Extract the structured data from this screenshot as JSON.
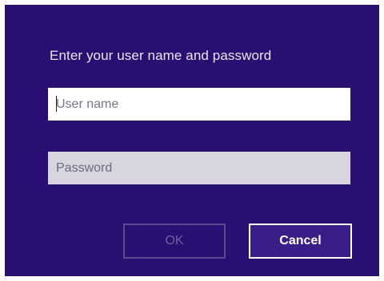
{
  "dialog": {
    "prompt": "Enter your user name and password",
    "username": {
      "placeholder": "User name",
      "value": ""
    },
    "password": {
      "placeholder": "Password",
      "value": ""
    },
    "buttons": {
      "ok_label": "OK",
      "ok_enabled": false,
      "cancel_label": "Cancel"
    }
  },
  "colors": {
    "background": "#2a0f72",
    "accent_border": "#ffffff"
  }
}
